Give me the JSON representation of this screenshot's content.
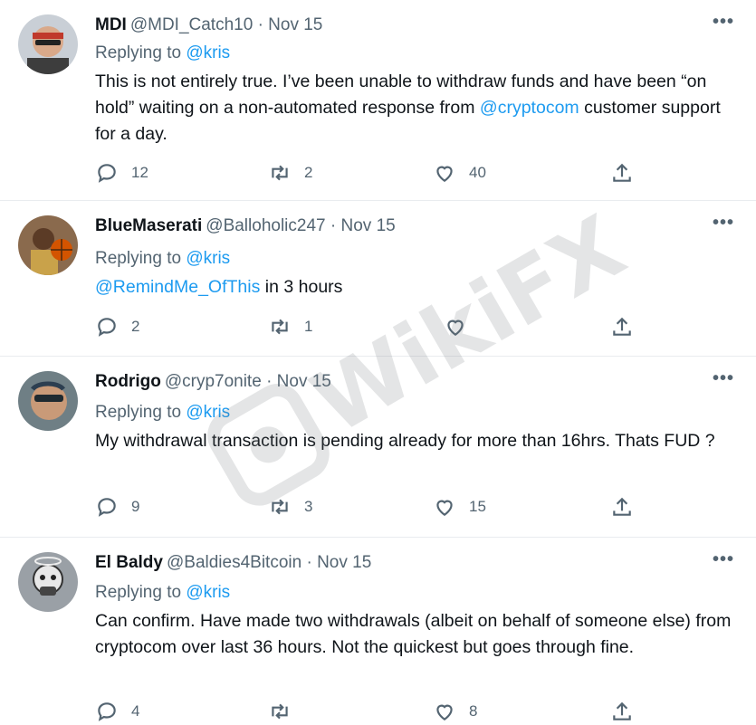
{
  "tweets": [
    {
      "name": "MDI",
      "handle": "@MDI_Catch10",
      "date": "Nov 15",
      "replying_prefix": "Replying to ",
      "replying_to": "@kris",
      "body_parts": [
        "This is not entirely true. I’ve been unable to withdraw funds and have been “on hold” waiting on a non-automated response from ",
        "@cryptocom",
        " customer support for a day."
      ],
      "replies": "12",
      "retweets": "2",
      "likes": "40"
    },
    {
      "name": "BlueMaserati",
      "handle": "@Balloholic247",
      "date": "Nov 15",
      "replying_prefix": "Replying to ",
      "replying_to": "@kris",
      "body_parts": [
        "",
        "@RemindMe_OfThis",
        " in 3 hours"
      ],
      "replies": "2",
      "retweets": "1",
      "likes": ""
    },
    {
      "name": "Rodrigo",
      "handle": "@cryp7onite",
      "date": "Nov 15",
      "replying_prefix": "Replying to ",
      "replying_to": "@kris",
      "body_parts": [
        "My withdrawal transaction is pending already for more than 16hrs. Thats FUD ?",
        "",
        ""
      ],
      "replies": "9",
      "retweets": "3",
      "likes": "15"
    },
    {
      "name": "El Baldy",
      "handle": "@Baldies4Bitcoin",
      "date": "Nov 15",
      "replying_prefix": "Replying to ",
      "replying_to": "@kris",
      "body_parts": [
        "Can confirm. Have made two withdrawals (albeit on behalf of someone else) from cryptocom over last 36 hours. Not the quickest but goes through fine.",
        "",
        ""
      ],
      "replies": "4",
      "retweets": "",
      "likes": "8"
    }
  ],
  "separator": "·",
  "more_label": "•••",
  "watermark": "WikiFX",
  "colors": {
    "link": "#1d9bf0",
    "secondary": "#536471",
    "text": "#0f1419"
  },
  "icons": [
    "reply-icon",
    "retweet-icon",
    "like-icon",
    "share-icon",
    "more-icon"
  ]
}
